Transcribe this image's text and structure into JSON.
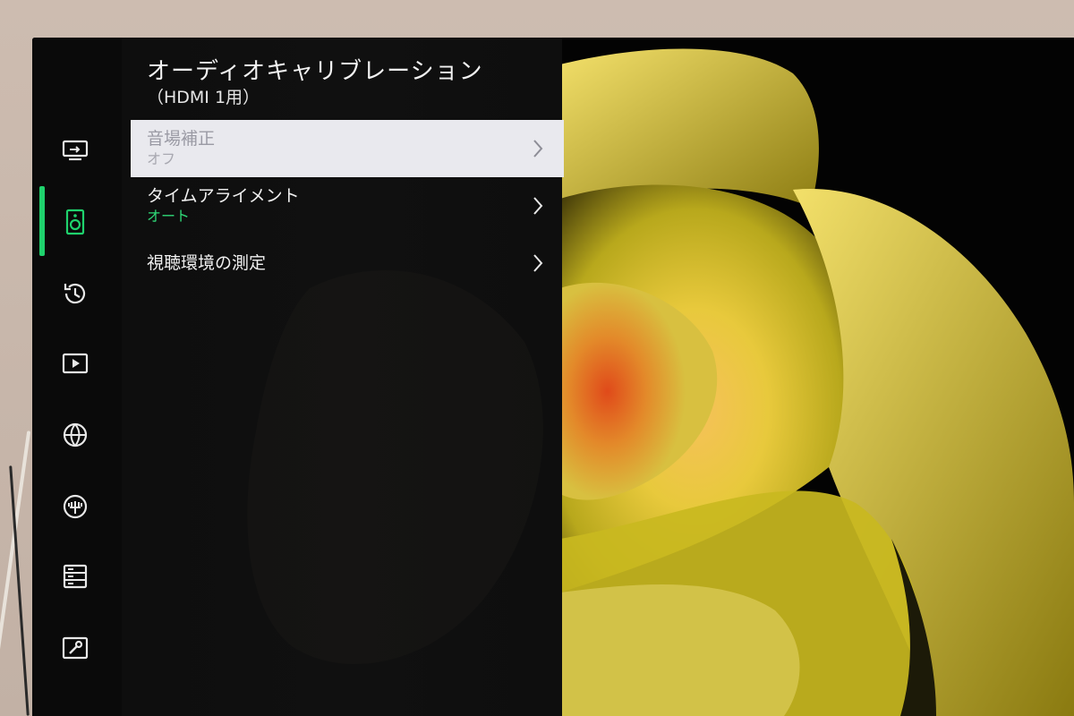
{
  "menu": {
    "title": "オーディオキャリブレーション",
    "subtitle": "（HDMI 1用）",
    "items": [
      {
        "label": "音場補正",
        "value": "オフ"
      },
      {
        "label": "タイムアライメント",
        "value": "オート"
      },
      {
        "label": "視聴環境の測定",
        "value": ""
      }
    ]
  },
  "sidebar": {
    "icons": [
      "tv-input-icon",
      "speaker-icon",
      "history-icon",
      "play-icon",
      "globe-icon",
      "antenna-icon",
      "storage-icon",
      "settings-wrench-icon"
    ],
    "selected_index": 1
  },
  "colors": {
    "accent": "#1fd26d",
    "selected_row_bg": "#e9e9ee",
    "value_highlight": "#2fd877"
  }
}
